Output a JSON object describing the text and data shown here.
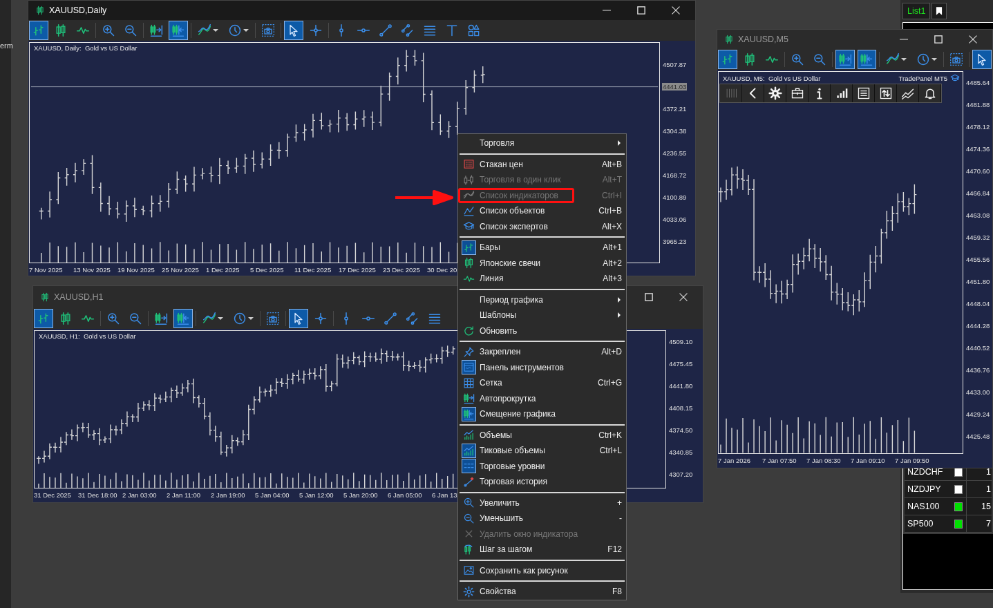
{
  "side_panel": {
    "text": "erm"
  },
  "windows": [
    {
      "title": "XAUUSD,Daily",
      "active": true,
      "toolbar": [
        {
          "kind": "bars",
          "selected": true
        },
        {
          "kind": "candles",
          "selected": false
        },
        {
          "kind": "line",
          "selected": false
        },
        {
          "kind": "separator"
        },
        {
          "kind": "zoom-in",
          "selected": false
        },
        {
          "kind": "zoom-out",
          "selected": false
        },
        {
          "kind": "separator"
        },
        {
          "kind": "autoscroll",
          "selected": false
        },
        {
          "kind": "shift",
          "selected": true
        },
        {
          "kind": "separator"
        },
        {
          "kind": "indicators",
          "selected": false
        },
        {
          "kind": "period",
          "selected": false
        },
        {
          "kind": "separator"
        },
        {
          "kind": "screenshot",
          "selected": false
        },
        {
          "kind": "separator"
        },
        {
          "kind": "cursor",
          "selected": true
        },
        {
          "kind": "crosshair",
          "selected": false
        },
        {
          "kind": "separator"
        },
        {
          "kind": "vline",
          "selected": false
        },
        {
          "kind": "hline",
          "selected": false
        },
        {
          "kind": "trendline",
          "selected": false
        },
        {
          "kind": "channel",
          "selected": false
        },
        {
          "kind": "fibo",
          "selected": false
        },
        {
          "kind": "text",
          "selected": false
        },
        {
          "kind": "shapes",
          "selected": false
        }
      ],
      "chart": {
        "header": "XAUUSD, Daily:  Gold vs US Dollar",
        "price_labels": [
          {
            "text": "4507.87",
            "highlighted": false
          },
          {
            "text": "4441.03",
            "highlighted": true
          },
          {
            "text": "4372.21",
            "highlighted": false
          },
          {
            "text": "4304.38",
            "highlighted": false
          },
          {
            "text": "4236.55",
            "highlighted": false
          },
          {
            "text": "4168.72",
            "highlighted": false
          },
          {
            "text": "4100.89",
            "highlighted": false
          },
          {
            "text": "4033.06",
            "highlighted": false
          },
          {
            "text": "3965.23",
            "highlighted": false
          }
        ],
        "time_labels": [
          "7 Nov 2025",
          "13 Nov 2025",
          "19 Nov 2025",
          "25 Nov 2025",
          "1 Dec 2025",
          "5 Dec 2025",
          "11 Dec 2025",
          "17 Dec 2025",
          "23 Dec 2025",
          "30 Dec 20"
        ]
      }
    },
    {
      "title": "XAUUSD,H1",
      "active": false,
      "toolbar": [
        {
          "kind": "bars",
          "selected": true
        },
        {
          "kind": "candles",
          "selected": false
        },
        {
          "kind": "line",
          "selected": false
        },
        {
          "kind": "separator"
        },
        {
          "kind": "zoom-in",
          "selected": false
        },
        {
          "kind": "zoom-out",
          "selected": false
        },
        {
          "kind": "separator"
        },
        {
          "kind": "autoscroll",
          "selected": false
        },
        {
          "kind": "shift",
          "selected": true
        },
        {
          "kind": "separator"
        },
        {
          "kind": "indicators",
          "selected": false
        },
        {
          "kind": "period",
          "selected": false
        },
        {
          "kind": "separator"
        },
        {
          "kind": "screenshot",
          "selected": false
        },
        {
          "kind": "separator"
        },
        {
          "kind": "cursor",
          "selected": true
        },
        {
          "kind": "crosshair",
          "selected": false
        },
        {
          "kind": "separator"
        },
        {
          "kind": "vline",
          "selected": false
        },
        {
          "kind": "hline",
          "selected": false
        },
        {
          "kind": "trendline",
          "selected": false
        },
        {
          "kind": "channel",
          "selected": false
        },
        {
          "kind": "fibo",
          "selected": false
        }
      ],
      "chart": {
        "header": "XAUUSD, H1:  Gold vs US Dollar",
        "price_labels": [
          {
            "text": "4509.10",
            "highlighted": false
          },
          {
            "text": "4475.45",
            "highlighted": false
          },
          {
            "text": "4441.80",
            "highlighted": false
          },
          {
            "text": "4408.15",
            "highlighted": false
          },
          {
            "text": "4374.50",
            "highlighted": false
          },
          {
            "text": "4340.85",
            "highlighted": false
          },
          {
            "text": "4307.20",
            "highlighted": false
          }
        ],
        "time_labels": [
          "31 Dec 2025",
          "31 Dec 18:00",
          "2 Jan 03:00",
          "2 Jan 11:00",
          "2 Jan 19:00",
          "5 Jan 04:00",
          "5 Jan 12:00",
          "5 Jan 20:00",
          "6 Jan 05:00",
          "6 Jan 13"
        ]
      }
    },
    {
      "title": "XAUUSD,M5",
      "active": false,
      "toolbar": [
        {
          "kind": "bars",
          "selected": true
        },
        {
          "kind": "candles",
          "selected": false
        },
        {
          "kind": "line",
          "selected": false
        },
        {
          "kind": "separator"
        },
        {
          "kind": "zoom-in",
          "selected": false
        },
        {
          "kind": "zoom-out",
          "selected": false
        },
        {
          "kind": "separator"
        },
        {
          "kind": "autoscroll",
          "selected": true
        },
        {
          "kind": "shift",
          "selected": true
        },
        {
          "kind": "separator"
        },
        {
          "kind": "indicators",
          "selected": false
        },
        {
          "kind": "period",
          "selected": false
        },
        {
          "kind": "separator"
        },
        {
          "kind": "screenshot",
          "selected": false
        },
        {
          "kind": "separator"
        },
        {
          "kind": "cursor",
          "selected": true
        }
      ],
      "chart": {
        "header": "XAUUSD, M5:  Gold vs US Dollar",
        "trade_panel": {
          "title": "TradePanel MT5"
        },
        "price_labels": [
          {
            "text": "4485.64",
            "highlighted": false
          },
          {
            "text": "4481.88",
            "highlighted": false
          },
          {
            "text": "4478.12",
            "highlighted": false
          },
          {
            "text": "4474.36",
            "highlighted": false
          },
          {
            "text": "4470.60",
            "highlighted": false
          },
          {
            "text": "4466.84",
            "highlighted": false
          },
          {
            "text": "4463.08",
            "highlighted": false
          },
          {
            "text": "4459.32",
            "highlighted": false
          },
          {
            "text": "4455.56",
            "highlighted": false
          },
          {
            "text": "4451.80",
            "highlighted": false
          },
          {
            "text": "4448.04",
            "highlighted": false
          },
          {
            "text": "4444.28",
            "highlighted": false
          },
          {
            "text": "4440.52",
            "highlighted": false
          },
          {
            "text": "4436.76",
            "highlighted": false
          },
          {
            "text": "4433.00",
            "highlighted": false
          },
          {
            "text": "4429.24",
            "highlighted": false
          },
          {
            "text": "4425.48",
            "highlighted": false
          }
        ],
        "time_labels": [
          "7 Jan 2026",
          "7 Jan 07:50",
          "7 Jan 08:30",
          "7 Jan 09:10",
          "7 Jan 09:50"
        ]
      }
    }
  ],
  "symbol_list": {
    "tab": "List1",
    "rows": [
      {
        "symbol": "NZDCHF",
        "color": "#ffffff",
        "column_3": "1"
      },
      {
        "symbol": "NZDJPY",
        "color": "#ffffff",
        "column_3": "1"
      },
      {
        "symbol": "NAS100",
        "color": "#00e000",
        "column_3": "15"
      },
      {
        "symbol": "SP500",
        "color": "#00e000",
        "column_3": "7"
      }
    ]
  },
  "menu": {
    "items": [
      {
        "kind": "submenu",
        "label": "Торговля",
        "disabled": false,
        "annotated": false
      },
      {
        "kind": "separator"
      },
      {
        "kind": "item",
        "label": "Стакан цен",
        "shortcut": "Alt+B",
        "disabled": false,
        "checked": false,
        "annotated": false
      },
      {
        "kind": "item",
        "label": "Торговля в один клик",
        "shortcut": "Alt+T",
        "disabled": true,
        "checked": false,
        "annotated": false
      },
      {
        "kind": "item",
        "label": "Список индикаторов",
        "shortcut": "Ctrl+I",
        "disabled": true,
        "checked": false,
        "annotated": true
      },
      {
        "kind": "item",
        "label": "Список объектов",
        "shortcut": "Ctrl+B",
        "disabled": false,
        "checked": false,
        "annotated": false
      },
      {
        "kind": "item",
        "label": "Список экспертов",
        "shortcut": "Alt+X",
        "disabled": false,
        "checked": false,
        "annotated": false
      },
      {
        "kind": "separator"
      },
      {
        "kind": "item",
        "label": "Бары",
        "shortcut": "Alt+1",
        "disabled": false,
        "checked": true,
        "annotated": false
      },
      {
        "kind": "item",
        "label": "Японские свечи",
        "shortcut": "Alt+2",
        "disabled": false,
        "checked": false,
        "annotated": false
      },
      {
        "kind": "item",
        "label": "Линия",
        "shortcut": "Alt+3",
        "disabled": false,
        "checked": false,
        "annotated": false
      },
      {
        "kind": "separator"
      },
      {
        "kind": "submenu",
        "label": "Период графика",
        "disabled": false,
        "annotated": false
      },
      {
        "kind": "submenu",
        "label": "Шаблоны",
        "disabled": false,
        "annotated": false
      },
      {
        "kind": "item",
        "label": "Обновить",
        "disabled": false,
        "checked": false,
        "annotated": false
      },
      {
        "kind": "separator"
      },
      {
        "kind": "item",
        "label": "Закреплен",
        "shortcut": "Alt+D",
        "disabled": false,
        "checked": false,
        "annotated": false
      },
      {
        "kind": "item",
        "label": "Панель инструментов",
        "disabled": false,
        "checked": true,
        "annotated": false
      },
      {
        "kind": "item",
        "label": "Сетка",
        "shortcut": "Ctrl+G",
        "disabled": false,
        "checked": false,
        "annotated": false
      },
      {
        "kind": "item",
        "label": "Автопрокрутка",
        "disabled": false,
        "checked": false,
        "annotated": false
      },
      {
        "kind": "item",
        "label": "Смещение графика",
        "disabled": false,
        "checked": true,
        "annotated": false
      },
      {
        "kind": "separator"
      },
      {
        "kind": "item",
        "label": "Объемы",
        "shortcut": "Ctrl+K",
        "disabled": false,
        "checked": false,
        "annotated": false
      },
      {
        "kind": "item",
        "label": "Тиковые объемы",
        "shortcut": "Ctrl+L",
        "disabled": false,
        "checked": true,
        "annotated": false
      },
      {
        "kind": "item",
        "label": "Торговые уровни",
        "disabled": false,
        "checked": true,
        "annotated": false
      },
      {
        "kind": "item",
        "label": "Торговая история",
        "disabled": false,
        "checked": false,
        "annotated": false
      },
      {
        "kind": "separator"
      },
      {
        "kind": "item",
        "label": "Увеличить",
        "shortcut": "+",
        "disabled": false,
        "checked": false,
        "annotated": false
      },
      {
        "kind": "item",
        "label": "Уменьшить",
        "shortcut": "-",
        "disabled": false,
        "checked": false,
        "annotated": false
      },
      {
        "kind": "item",
        "label": "Удалить окно индикатора",
        "disabled": true,
        "checked": false,
        "annotated": false
      },
      {
        "kind": "item",
        "label": "Шаг за шагом",
        "shortcut": "F12",
        "disabled": false,
        "checked": false,
        "annotated": false
      },
      {
        "kind": "separator"
      },
      {
        "kind": "item",
        "label": "Сохранить как рисунок",
        "disabled": false,
        "checked": false,
        "annotated": false
      },
      {
        "kind": "separator"
      },
      {
        "kind": "item",
        "label": "Свойства",
        "shortcut": "F8",
        "disabled": false,
        "checked": false,
        "annotated": false
      }
    ]
  }
}
